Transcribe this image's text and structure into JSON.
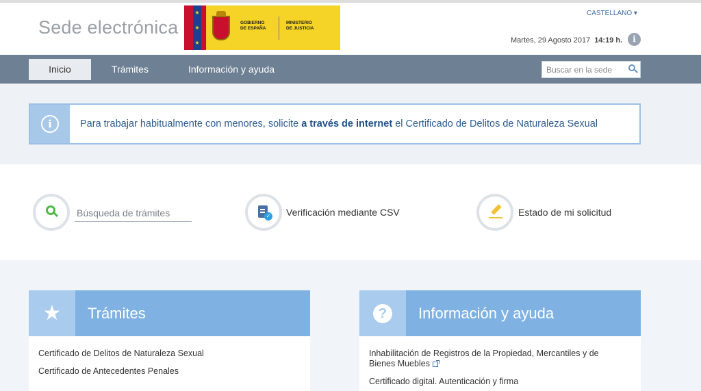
{
  "header": {
    "site_title": "Sede electrónica",
    "gov_text_line1": "GOBIERNO",
    "gov_text_line2": "DE ESPAÑA",
    "ministry_line1": "MINISTERIO",
    "ministry_line2": "DE JUSTICIA",
    "language": "CASTELLANO ▾",
    "date": "Martes, 29 Agosto 2017",
    "time": "14:19 h.",
    "info_icon": "i"
  },
  "nav": {
    "items": [
      {
        "label": "Inicio",
        "active": true
      },
      {
        "label": "Trámites",
        "active": false
      },
      {
        "label": "Información y ayuda",
        "active": false
      }
    ],
    "search_placeholder": "Buscar en la sede"
  },
  "alert": {
    "icon": "i",
    "text_before": "Para trabajar habitualmente con menores, solicite ",
    "link_text": "a través de internet",
    "text_after": " el Certificado de Delitos de Naturaleza Sexual"
  },
  "quick": {
    "search_placeholder": "Búsqueda de trámites",
    "csv_label": "Verificación mediante CSV",
    "status_label": "Estado de mi solicitud"
  },
  "panels": {
    "tramites": {
      "title": "Trámites",
      "icon": "★",
      "links": [
        "Certificado de Delitos de Naturaleza Sexual",
        "Certificado de Antecedentes Penales"
      ]
    },
    "info": {
      "title": "Información y ayuda",
      "icon": "?",
      "links": [
        "Inhabilitación de Registros de la Propiedad, Mercantiles y de Bienes Muebles",
        "Certificado digital. Autenticación y firma"
      ]
    }
  },
  "colors": {
    "nav_bg": "#6e8093",
    "panel_head": "#7fb1e3",
    "link_blue": "#2d5c8f",
    "gov_yellow": "#f5d327"
  }
}
